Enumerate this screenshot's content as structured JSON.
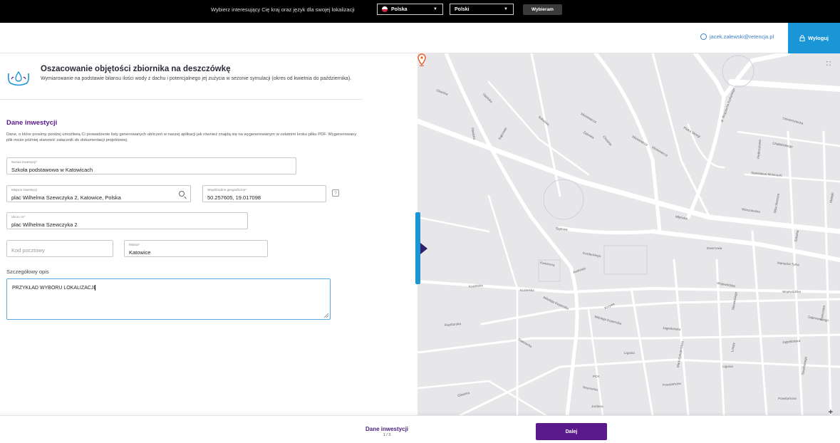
{
  "locale_bar": {
    "prompt": "Wybierz interesujący Cię kraj oraz język dla swojej lokalizacji",
    "country": "Polska",
    "language": "Polski",
    "choose_button": "Wybieram"
  },
  "header": {
    "user_email": "jacek.zalewski@retencja.pl",
    "logout_label": "Wyloguj"
  },
  "page": {
    "title": "Oszacowanie objętości zbiornika na deszczówkę",
    "subtitle": "Wymiarowanie na podstawie bilansu ilości wody z dachu i potencjalnego jej zużycia w sezonie symulacji (okres od kwietnia do października)."
  },
  "section": {
    "title": "Dane inwestycji",
    "description": "Dane, o które prosimy poniżej umożliwią Ci prowadzenie listy generowanych obliczeń w naszej aplikacji jak również znajdą się na wygenerowanym w ostatnim kroku pliku PDF. Wygenerowany plik może później stanowić załącznik do dokumentacji projektowej."
  },
  "form": {
    "name": {
      "label": "Nazwa inwestycji*",
      "value": "Szkoła podstawowa w Katowicach"
    },
    "place": {
      "label": "Miejsce inwestycji",
      "value": "plac Wilhelma Szewczyka 2, Katowice, Polska"
    },
    "coords": {
      "label": "Współrzędne geograficzne*",
      "value": "50.257605, 19.017098"
    },
    "street": {
      "label": "Ulica i nr*",
      "value": "plac Wilhelma Szewczyka 2"
    },
    "zip": {
      "placeholder": "Kod pocztowy"
    },
    "city": {
      "label": "Miasto*",
      "value": "Katowice"
    },
    "description": {
      "label": "Szczegółowy opis",
      "value": "PRZYKŁAD WYBORU LOKALIZACJI"
    },
    "help_glyph": "?"
  },
  "map": {
    "labels": {
      "zabrze": "Gliwicka",
      "opolska": "Opolska",
      "gliwicka": "Gliwicka",
      "dabrowka": "Dąbrówki",
      "sokolska": "Sokolska",
      "mickiewicza1": "Mickiewicza",
      "mickiewicza2": "Mickiewicza",
      "chopina": "Chopina",
      "zabrska": "Zabrska",
      "mickiewicza3": "Mickiewicza",
      "pullaskarg": "Piotra Skargi",
      "korfantego": "al. Wojciecha Korfantego",
      "uniwersytecka": "Uniwersytecka",
      "chalbinskiego": "Chałbińskiego",
      "plebiscytowa": "Plebiscytowa",
      "moniuszki": "Stanisława Moniuszki",
      "wita": "Wita Stwosza",
      "warszawska": "Warszawska",
      "mlynska": "Młyńska",
      "sadowa": "Sądowa",
      "kordeckiego": "Kordeckiego",
      "dworcowa": "Dworcowa",
      "mariacka": "Mariacka Tylna",
      "kamienna": "Kamienna",
      "andrzeja": "Andrzeja",
      "kozielska": "Kozielska",
      "kozielska2": "Kozielska",
      "wojewodzka": "Wojewódzka",
      "wojewodzka2": "Wojewódzka",
      "raciborska": "Raciborska",
      "kopernika": "Mikołaja Kopernika",
      "kopernika2": "Mikołaja Kopernika",
      "jagiellonska": "Jagiellońska",
      "jagiellonska2": "Jagiellońska",
      "ligonia": "Ligonia",
      "ligonia2": "Ligonia",
      "powstancow": "Powstańców",
      "pck": "PCK",
      "stalmacha": "Stalmacha",
      "krzywa": "Krzywa",
      "reymonta": "Reymonta",
      "jordana": "Jordana",
      "lompy": "Lompy",
      "sowinskiego": "Sowińskiego",
      "francuska": "Francuska",
      "slowackiego": "Słowackiego",
      "marii": "Marii Konopnickiej",
      "szkolna": "Szkolna",
      "matejki": "Matejki",
      "powstancow2": "Powstańców",
      "dabrowskiego": "Dąbrowskiego",
      "gliwicka2": "Gliwicka"
    },
    "fullscreen_glyph": "⛶",
    "zoom_in_glyph": "+"
  },
  "footer": {
    "step_name": "Dane inwestycji",
    "step_count": "1 / 3",
    "next_label": "Dalej"
  },
  "colors": {
    "brand_purple": "#5a1a8c",
    "accent_blue": "#1a95d5",
    "pin_orange": "#e8612c"
  }
}
